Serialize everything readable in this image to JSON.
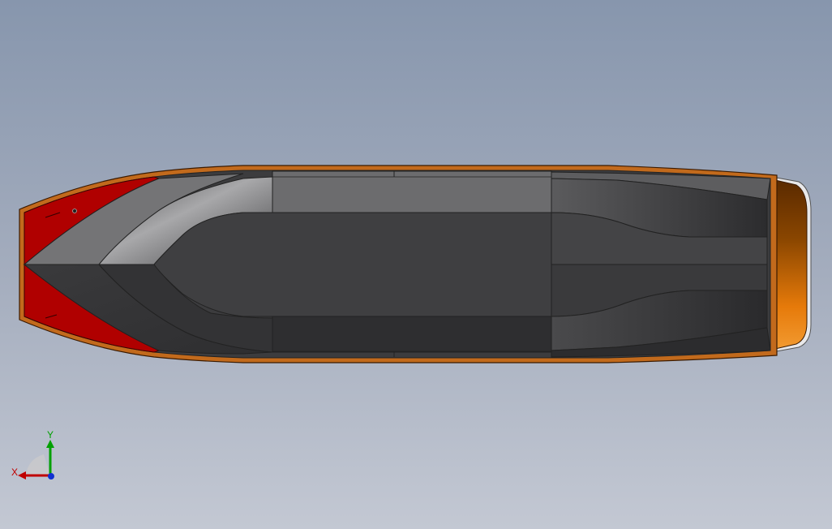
{
  "viewport": {
    "background_top": "#8796ad",
    "background_bottom": "#c3c8d3"
  },
  "model": {
    "name": "boat-hull",
    "colors": {
      "deck_dark": "#3d3d3f",
      "deck_mid": "#555557",
      "deck_light": "#6e6e70",
      "bow_red": "#b00000",
      "rim_copper": "#b5651d",
      "transom_orange": "#e0780a",
      "transom_dark": "#6a3300"
    }
  },
  "triad": {
    "x_label": "X",
    "y_label": "Y",
    "x_color": "#c00000",
    "y_color": "#00a000",
    "z_color": "#1030d0"
  }
}
